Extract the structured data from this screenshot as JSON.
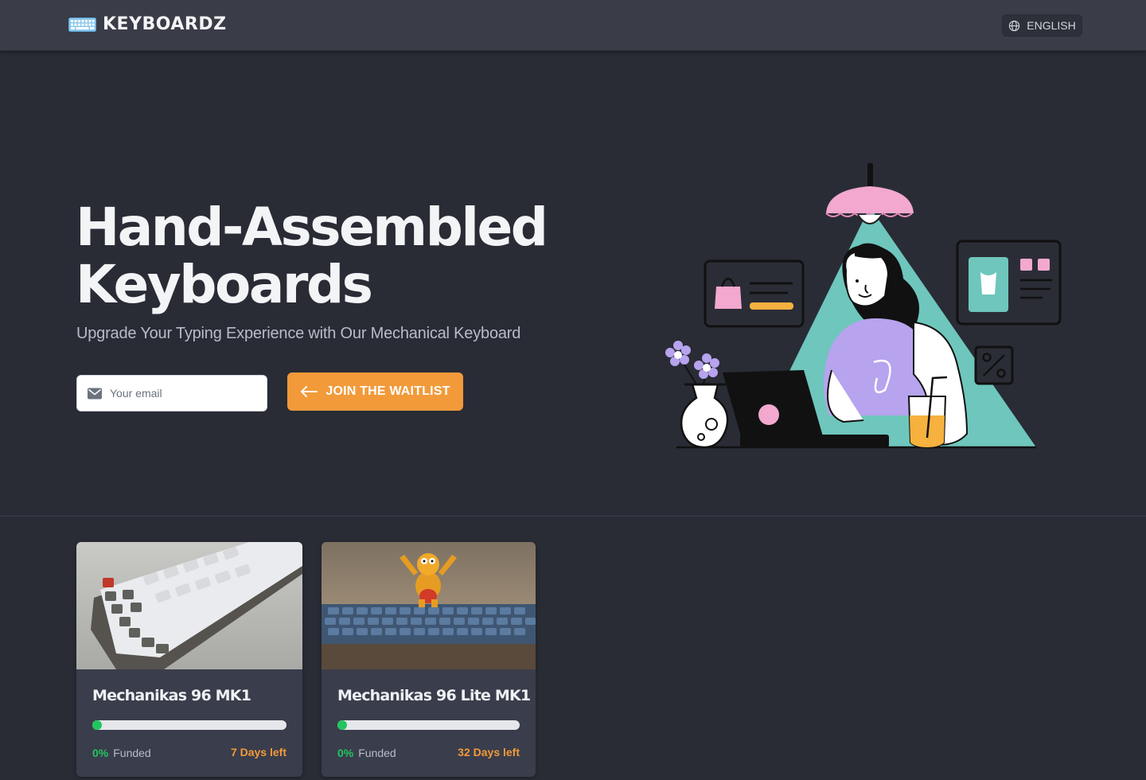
{
  "header": {
    "brand": "KEYBOARDZ",
    "language": "ENGLISH"
  },
  "hero": {
    "title_line1": "Hand-Assembled",
    "title_line2": "Keyboards",
    "subtitle": "Upgrade Your Typing Experience with Our Mechanical Keyboard",
    "email_placeholder": "Your email",
    "email_value": "",
    "cta_label": "JOIN THE WAITLIST"
  },
  "products": [
    {
      "name": "Mechanikas 96 MK1",
      "funded_pct": 0,
      "funded_text": "0%",
      "funded_label": "Funded",
      "days_left": "7 Days left"
    },
    {
      "name": "Mechanikas 96 Lite MK1",
      "funded_pct": 0,
      "funded_text": "0%",
      "funded_label": "Funded",
      "days_left": "32 Days left"
    }
  ],
  "colors": {
    "accent": "#f29a3a",
    "success": "#22c55e",
    "background": "#292c35",
    "header": "#3a3c47",
    "card": "#3a3d4b"
  },
  "icons": {
    "brand": "keyboard-icon",
    "language": "globe-icon",
    "email": "mail-icon",
    "cta": "arrow-left-icon"
  }
}
